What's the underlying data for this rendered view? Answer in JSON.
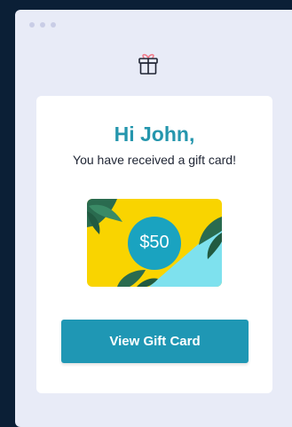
{
  "greeting": "Hi John,",
  "message": "You have received a gift card!",
  "gift_card": {
    "amount": "$50",
    "background_colors": [
      "#f9d400",
      "#7ee1ee"
    ],
    "badge_color": "#1aa3c0"
  },
  "button": {
    "label": "View Gift Card",
    "color": "#1f97b4"
  },
  "colors": {
    "greeting": "#2596ad",
    "page_background": "#0b1f36",
    "window_background": "#e8ebf7"
  },
  "icons": {
    "header": "gift-icon",
    "window_controls": [
      "window-dot",
      "window-dot",
      "window-dot"
    ]
  }
}
